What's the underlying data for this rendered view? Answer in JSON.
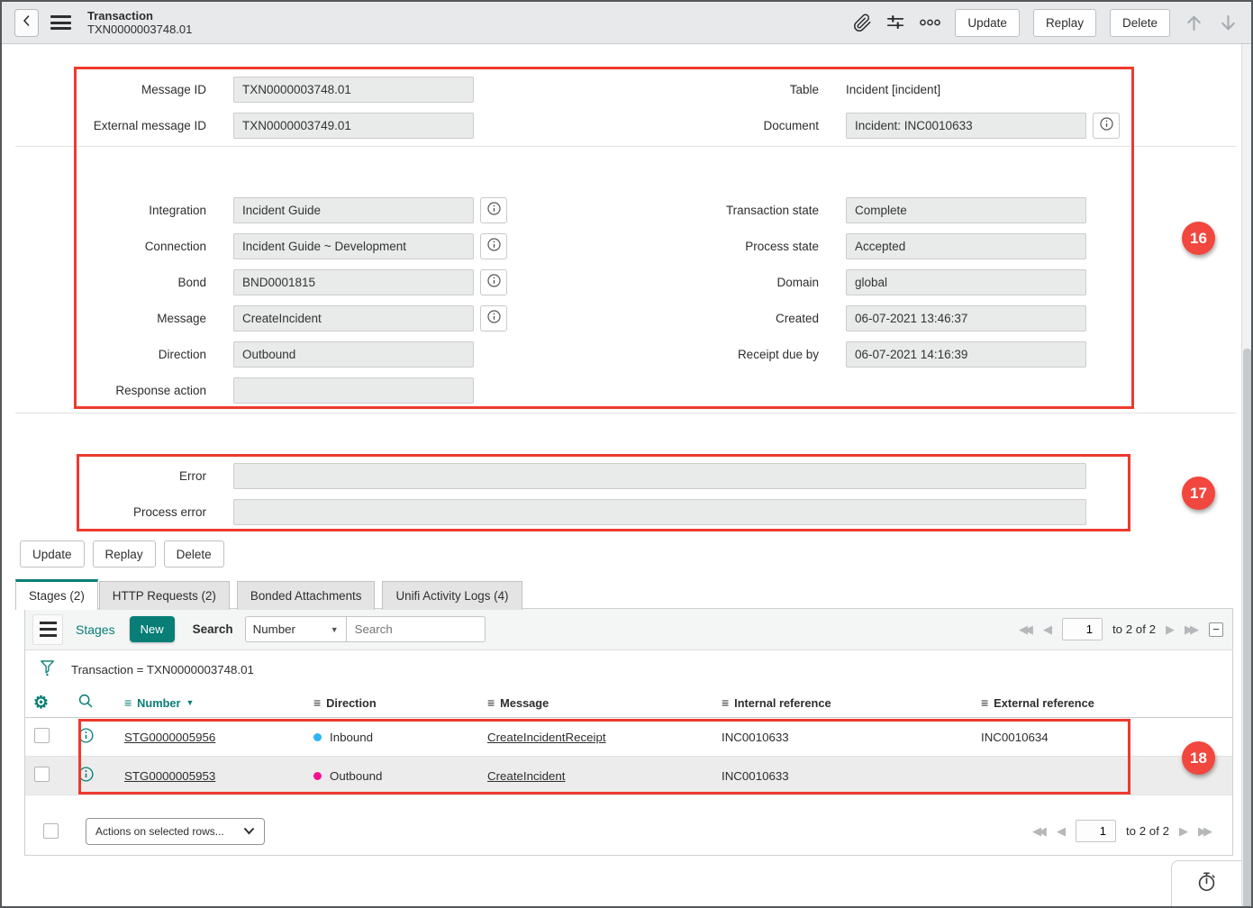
{
  "header": {
    "title": "Transaction",
    "record_number": "TXN0000003748.01",
    "update_label": "Update",
    "replay_label": "Replay",
    "delete_label": "Delete"
  },
  "form": {
    "message_id": {
      "label": "Message ID",
      "value": "TXN0000003748.01"
    },
    "external_message_id": {
      "label": "External message ID",
      "value": "TXN0000003749.01"
    },
    "table": {
      "label": "Table",
      "value": "Incident [incident]"
    },
    "document": {
      "label": "Document",
      "value": "Incident: INC0010633"
    },
    "integration": {
      "label": "Integration",
      "value": "Incident Guide"
    },
    "connection": {
      "label": "Connection",
      "value": "Incident Guide ~ Development"
    },
    "bond": {
      "label": "Bond",
      "value": "BND0001815"
    },
    "message": {
      "label": "Message",
      "value": "CreateIncident"
    },
    "direction": {
      "label": "Direction",
      "value": "Outbound"
    },
    "response_action": {
      "label": "Response action",
      "value": ""
    },
    "transaction_state": {
      "label": "Transaction state",
      "value": "Complete"
    },
    "process_state": {
      "label": "Process state",
      "value": "Accepted"
    },
    "domain": {
      "label": "Domain",
      "value": "global"
    },
    "created": {
      "label": "Created",
      "value": "06-07-2021 13:46:37"
    },
    "receipt_due_by": {
      "label": "Receipt due by",
      "value": "06-07-2021 14:16:39"
    },
    "error": {
      "label": "Error",
      "value": ""
    },
    "process_error": {
      "label": "Process error",
      "value": ""
    }
  },
  "form_buttons": {
    "update": "Update",
    "replay": "Replay",
    "delete": "Delete"
  },
  "tabs": [
    {
      "label": "Stages (2)",
      "active": true
    },
    {
      "label": "HTTP Requests (2)",
      "active": false
    },
    {
      "label": "Bonded Attachments",
      "active": false
    },
    {
      "label": "Unifi Activity Logs (4)",
      "active": false
    }
  ],
  "list": {
    "title": "Stages",
    "new_button": "New",
    "search_label": "Search",
    "search_column": "Number",
    "search_placeholder": "Search",
    "filter_text": "Transaction = TXN0000003748.01",
    "pagination": {
      "page": "1",
      "range_text": "to 2 of 2"
    },
    "columns": {
      "number": "Number",
      "direction": "Direction",
      "message": "Message",
      "internal_reference": "Internal reference",
      "external_reference": "External reference"
    },
    "sorted_column": "Number",
    "rows": [
      {
        "number": "STG0000005956",
        "direction": "Inbound",
        "message": "CreateIncidentReceipt",
        "internal_reference": "INC0010633",
        "external_reference": "INC0010634"
      },
      {
        "number": "STG0000005953",
        "direction": "Outbound",
        "message": "CreateIncident",
        "internal_reference": "INC0010633",
        "external_reference": ""
      }
    ],
    "actions_placeholder": "Actions on selected rows..."
  },
  "annotations": {
    "box16": "16",
    "box17": "17",
    "box18": "18"
  },
  "icons": {
    "header": [
      "back-chevron",
      "context-menu",
      "paperclip",
      "sliders",
      "more-options",
      "scroll-up-arrow",
      "scroll-down-arrow"
    ],
    "list": [
      "list-menu",
      "filter-funnel",
      "gear",
      "search-magnifier",
      "info-circle"
    ],
    "footer": [
      "stopwatch"
    ]
  },
  "colors": {
    "accent_teal": "#087e76",
    "annotation_red": "#f2473e",
    "inbound_dot": "#2cb5f2",
    "outbound_dot": "#f7108f",
    "header_background": "#e7e9eb",
    "readonly_field_background": "#e9eaea"
  }
}
